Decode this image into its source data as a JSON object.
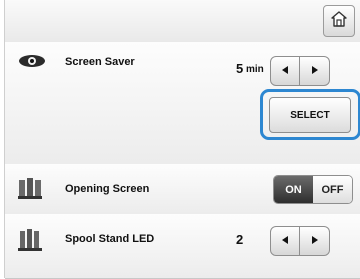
{
  "home_button": {
    "icon": "home-icon"
  },
  "screen_saver": {
    "icon": "eye-icon",
    "label": "Screen Saver",
    "value": "5",
    "unit": "min",
    "select_label": "SELECT",
    "highlight_color": "#2d87d1"
  },
  "opening_screen": {
    "icon": "opening-screen-icon",
    "label": "Opening Screen",
    "on_label": "ON",
    "off_label": "OFF",
    "state": "ON"
  },
  "spool_stand_led": {
    "icon": "spool-stand-icon",
    "label": "Spool Stand LED",
    "value": "2"
  }
}
